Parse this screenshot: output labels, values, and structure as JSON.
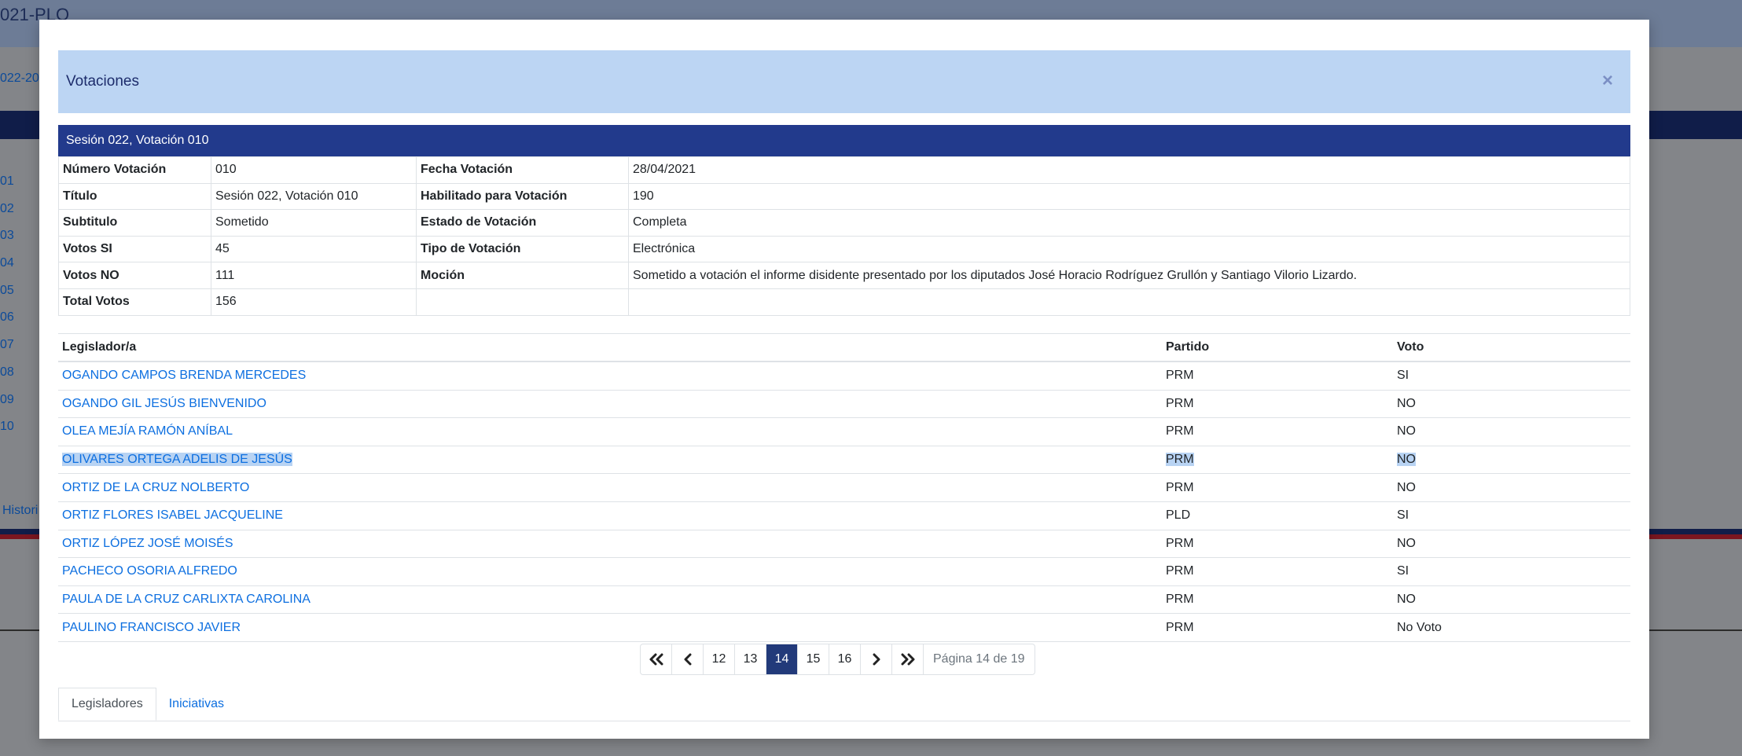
{
  "background": {
    "title": "021-PLO",
    "subtitle": "022-20",
    "list_items": [
      "01",
      "02",
      "03",
      "04",
      "05",
      "06",
      "07",
      "08",
      "09",
      "10"
    ],
    "history_link": "Histori"
  },
  "modal": {
    "title": "Votaciones",
    "close_label": "×"
  },
  "vote": {
    "caption": "Sesión 022, Votación 010",
    "rows": [
      {
        "k1": "Número Votación",
        "v1": "010",
        "k2": "Fecha Votación",
        "v2": "28/04/2021"
      },
      {
        "k1": "Título",
        "v1": "Sesión 022, Votación 010",
        "k2": "Habilitado para Votación",
        "v2": "190"
      },
      {
        "k1": "Subtitulo",
        "v1": "Sometido",
        "k2": "Estado de Votación",
        "v2": "Completa"
      },
      {
        "k1": "Votos SI",
        "v1": "45",
        "k2": "Tipo de Votación",
        "v2": "Electrónica"
      },
      {
        "k1": "Votos NO",
        "v1": "111",
        "k2": "Moción",
        "v2": "Sometido a votación el informe disidente presentado por los diputados José Horacio Rodríguez Grullón y Santiago Vilorio Lizardo."
      },
      {
        "k1": "Total Votos",
        "v1": "156",
        "k2": "",
        "v2": ""
      }
    ]
  },
  "legislators": {
    "headers": {
      "name": "Legislador/a",
      "party": "Partido",
      "vote": "Voto"
    },
    "rows": [
      {
        "name": "OGANDO CAMPOS BRENDA MERCEDES",
        "party": "PRM",
        "vote": "SI"
      },
      {
        "name": "OGANDO GIL JESÚS BIENVENIDO",
        "party": "PRM",
        "vote": "NO"
      },
      {
        "name": "OLEA MEJÍA RAMÓN ANÍBAL",
        "party": "PRM",
        "vote": "NO"
      },
      {
        "name": "OLIVARES ORTEGA ADELIS DE JESÚS",
        "party": "PRM",
        "vote": "NO"
      },
      {
        "name": "ORTIZ DE LA CRUZ NOLBERTO",
        "party": "PRM",
        "vote": "NO"
      },
      {
        "name": "ORTIZ FLORES ISABEL JACQUELINE",
        "party": "PLD",
        "vote": "SI"
      },
      {
        "name": "ORTIZ LÓPEZ JOSÉ MOISÉS",
        "party": "PRM",
        "vote": "NO"
      },
      {
        "name": "PACHECO OSORIA ALFREDO",
        "party": "PRM",
        "vote": "SI"
      },
      {
        "name": "PAULA DE LA CRUZ CARLIXTA CAROLINA",
        "party": "PRM",
        "vote": "NO"
      },
      {
        "name": "PAULINO FRANCISCO JAVIER",
        "party": "PRM",
        "vote": "No Voto"
      }
    ]
  },
  "pagination": {
    "first": "«",
    "prev": "‹",
    "pages": [
      "12",
      "13",
      "14",
      "15",
      "16"
    ],
    "active": "14",
    "next": "›",
    "last": "»",
    "info": "Página 14 de 19"
  },
  "tabs": {
    "legisladores": "Legisladores",
    "iniciativas": "Iniciativas"
  }
}
